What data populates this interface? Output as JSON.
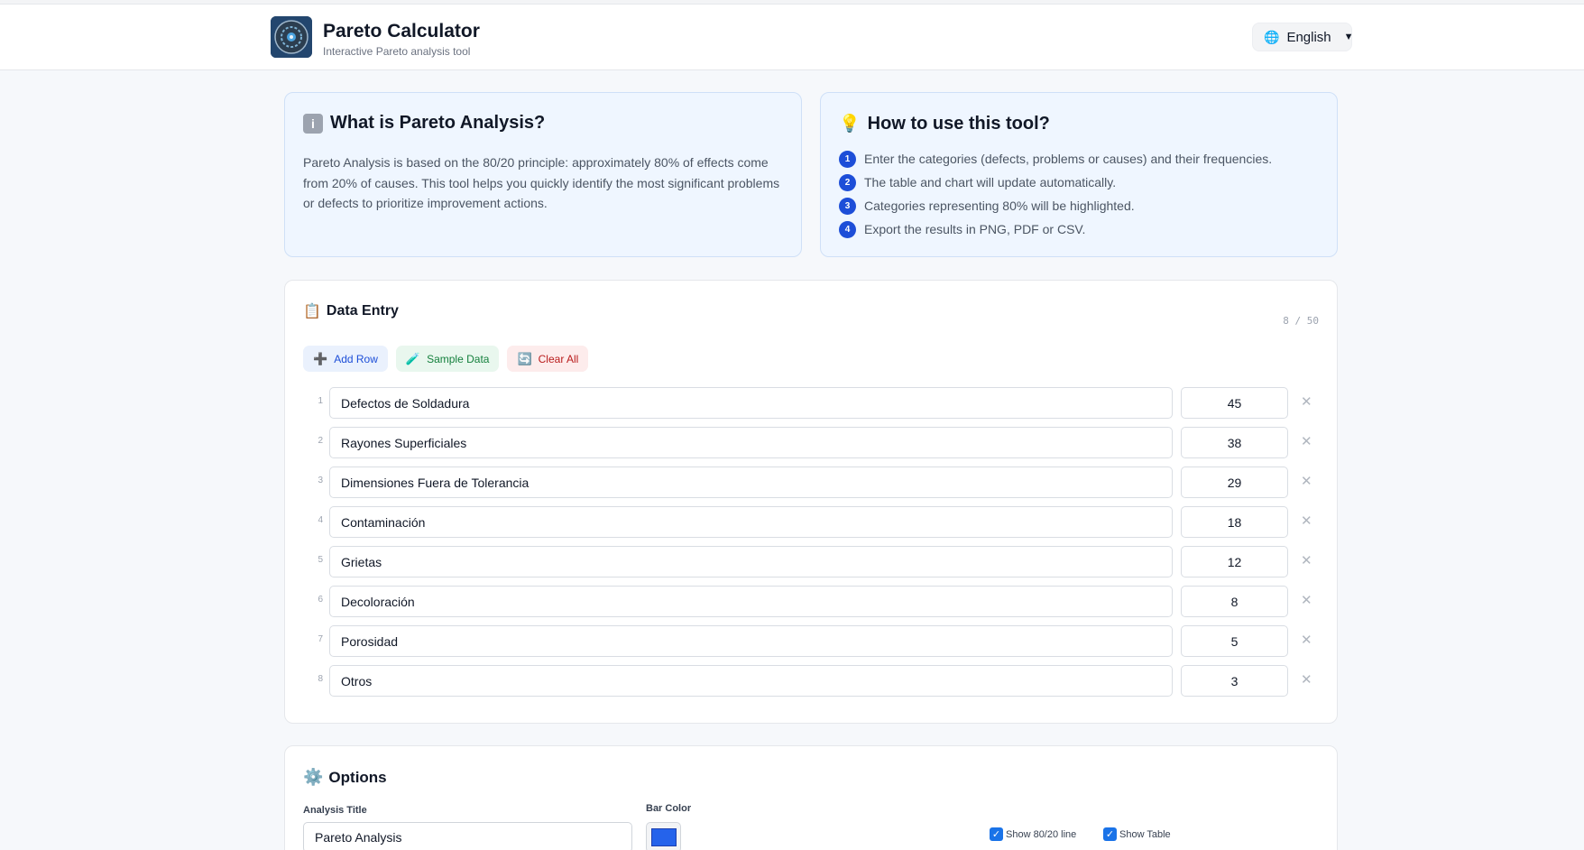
{
  "header": {
    "title": "Pareto Calculator",
    "subtitle": "Interactive Pareto analysis tool",
    "language": "English"
  },
  "about": {
    "title": "What is Pareto Analysis?",
    "text": "Pareto Analysis is based on the 80/20 principle: approximately 80% of effects come from 20% of causes. This tool helps you quickly identify the most significant problems or defects to prioritize improvement actions."
  },
  "howto": {
    "title": "How to use this tool?",
    "steps": [
      {
        "num": "1",
        "text": "Enter the categories (defects, problems or causes) and their frequencies."
      },
      {
        "num": "2",
        "text": "The table and chart will update automatically."
      },
      {
        "num": "3",
        "text": "Categories representing 80% will be highlighted."
      },
      {
        "num": "4",
        "text": "Export the results in PNG, PDF or CSV."
      }
    ]
  },
  "data_entry": {
    "title": "Data Entry",
    "counter": "8 / 50",
    "add_row": "Add Row",
    "sample_data": "Sample Data",
    "clear_all": "Clear All",
    "rows": [
      {
        "index": "1",
        "name": "Defectos de Soldadura",
        "value": "45"
      },
      {
        "index": "2",
        "name": "Rayones Superficiales",
        "value": "38"
      },
      {
        "index": "3",
        "name": "Dimensiones Fuera de Tolerancia",
        "value": "29"
      },
      {
        "index": "4",
        "name": "Contaminación",
        "value": "18"
      },
      {
        "index": "5",
        "name": "Grietas",
        "value": "12"
      },
      {
        "index": "6",
        "name": "Decoloración",
        "value": "8"
      },
      {
        "index": "7",
        "name": "Porosidad",
        "value": "5"
      },
      {
        "index": "8",
        "name": "Otros",
        "value": "3"
      }
    ]
  },
  "options": {
    "title": "Options",
    "analysis_title_label": "Analysis Title",
    "analysis_title_value": "Pareto Analysis",
    "bar_color_label": "Bar Color",
    "bar_color": "#2563eb",
    "show_line_label": "Show 80/20 line",
    "show_table_label": "Show Table"
  },
  "colors": {
    "accent": "#1d4ed8",
    "info_bg": "#eff6ff"
  }
}
